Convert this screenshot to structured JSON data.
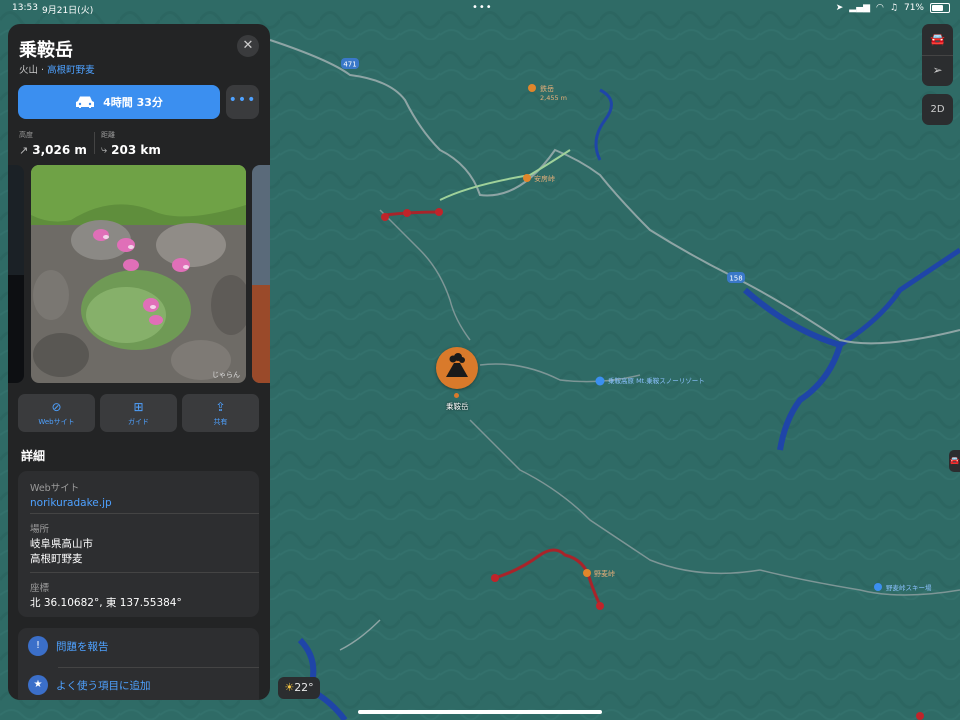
{
  "status_bar": {
    "time": "13:53",
    "date": "9月21日(火)",
    "battery": "71%",
    "battery_level": 0.71
  },
  "place": {
    "name": "乗鞍岳",
    "category": "火山",
    "location_link": "高根町野麦"
  },
  "directions": {
    "drive_label": "4時間 33分"
  },
  "stats": {
    "elevation_label": "高度",
    "elevation_value": "3,026 m",
    "distance_label": "距離",
    "distance_value": "203 km"
  },
  "photo": {
    "credit": "じゃらん"
  },
  "actions": [
    {
      "label": "Webサイト",
      "icon": "compass-icon"
    },
    {
      "label": "ガイド",
      "icon": "plus-icon"
    },
    {
      "label": "共有",
      "icon": "share-icon"
    }
  ],
  "details": {
    "heading": "詳細",
    "website_label": "Webサイト",
    "website_value": "norikuradake.jp",
    "address_label": "場所",
    "address_line1": "岐阜県高山市",
    "address_line2": "高根町野麦",
    "coords_label": "座標",
    "coords_value": "北 36.10682°, 東 137.55384°"
  },
  "more_actions": {
    "report": "問題を報告",
    "favorite": "よく使う項目に追加"
  },
  "map": {
    "view_mode": "2D",
    "temperature": "22°",
    "road_labels": [
      "471",
      "158"
    ],
    "poi_labels": {
      "peak_label": "乗鞍岳",
      "mountain_hut": "鉄岳",
      "mountain_hut_elevation": "2,455 m",
      "pass1": "安房峠",
      "resort": "乗鞍高原 Mt.乗鞍スノーリゾート",
      "pass2": "野麦峠",
      "ski": "野麦峠スキー場"
    }
  },
  "colors": {
    "accent": "#3b8ff0",
    "map_base": "#2f6b66",
    "water": "#1f45a8",
    "pin": "#d97a2b",
    "closed_road": "#a8242a"
  }
}
